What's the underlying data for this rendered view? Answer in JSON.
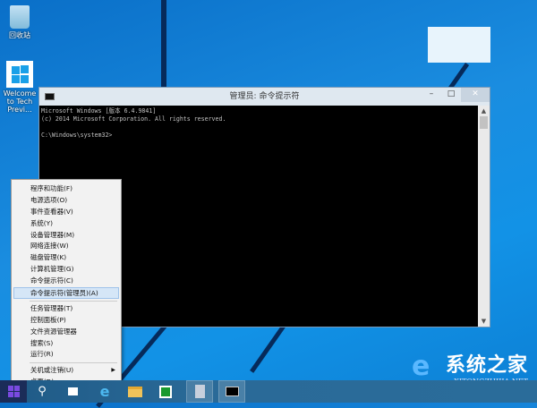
{
  "desktop": {
    "icons": [
      {
        "label": "回收站",
        "icon": "recycle-bin-icon"
      },
      {
        "label": "Welcome to Tech Previ...",
        "icon": "windows-logo-icon"
      }
    ]
  },
  "cmd_window": {
    "title": "管理员: 命令提示符",
    "lines": [
      "Microsoft Windows [版本 6.4.9841]",
      "(c) 2014 Microsoft Corporation. All rights reserved.",
      "",
      "C:\\Windows\\system32>"
    ],
    "minimize": "–",
    "maximize": "□",
    "close": "✕"
  },
  "context_menu": {
    "items": [
      "程序和功能(F)",
      "电源选项(O)",
      "事件查看器(V)",
      "系统(Y)",
      "设备管理器(M)",
      "网络连接(W)",
      "磁盘管理(K)",
      "计算机管理(G)",
      "命令提示符(C)",
      "命令提示符(管理员)(A)",
      "任务管理器(T)",
      "控制面板(P)",
      "文件资源管理器",
      "搜索(S)",
      "运行(R)",
      "关机或注销(U)",
      "桌面(D)"
    ],
    "highlighted_index": 9
  },
  "taskbar": {
    "items": [
      "start",
      "search",
      "task-view",
      "internet-explorer",
      "file-explorer",
      "store",
      "photos",
      "command-prompt"
    ]
  },
  "watermark": {
    "cn": "系统之家",
    "en": "XITONGZHIJIA.NET"
  },
  "colors": {
    "desktop": "#1a8de0",
    "highlight": "#d5e6f7",
    "taskbar": "#2a6a98"
  }
}
